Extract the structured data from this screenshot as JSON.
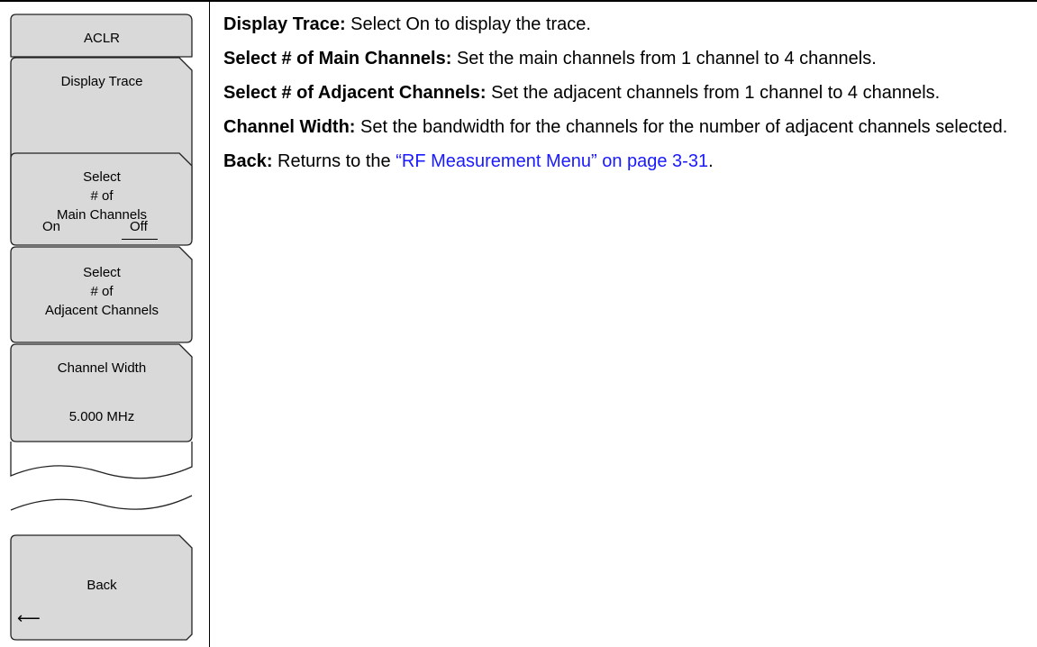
{
  "menu": {
    "title": "ACLR",
    "keys": [
      {
        "id": "display_trace",
        "label": "Display Trace",
        "options": [
          "On",
          "Off"
        ],
        "selected": "Off"
      },
      {
        "id": "main_channels",
        "lines": [
          "Select",
          "# of",
          "Main Channels"
        ]
      },
      {
        "id": "adjacent_channels",
        "lines": [
          "Select",
          "# of",
          "Adjacent Channels"
        ]
      },
      {
        "id": "channel_width",
        "label": "Channel Width",
        "value": "5.000 MHz"
      }
    ],
    "back": {
      "label": "Back",
      "icon": "left-arrow-icon",
      "glyph": "⟵"
    }
  },
  "descriptions": [
    {
      "term": "Display Trace:",
      "text": " Select On to display the trace."
    },
    {
      "term": "Select # of Main Channels:",
      "text": " Set the main channels from 1 channel to 4 channels."
    },
    {
      "term": "Select # of Adjacent Channels:",
      "text": " Set the adjacent channels from 1 channel to 4 channels."
    },
    {
      "term": "Channel Width:",
      "text": " Set the bandwidth for the channels for the number of adjacent channels selected."
    },
    {
      "term": "Back:",
      "text": " Returns to the ",
      "link": "“RF Measurement Menu” on page 3-31",
      "after": "."
    }
  ],
  "colors": {
    "key_fill": "#d9d9d9",
    "link": "#1a1aff"
  }
}
